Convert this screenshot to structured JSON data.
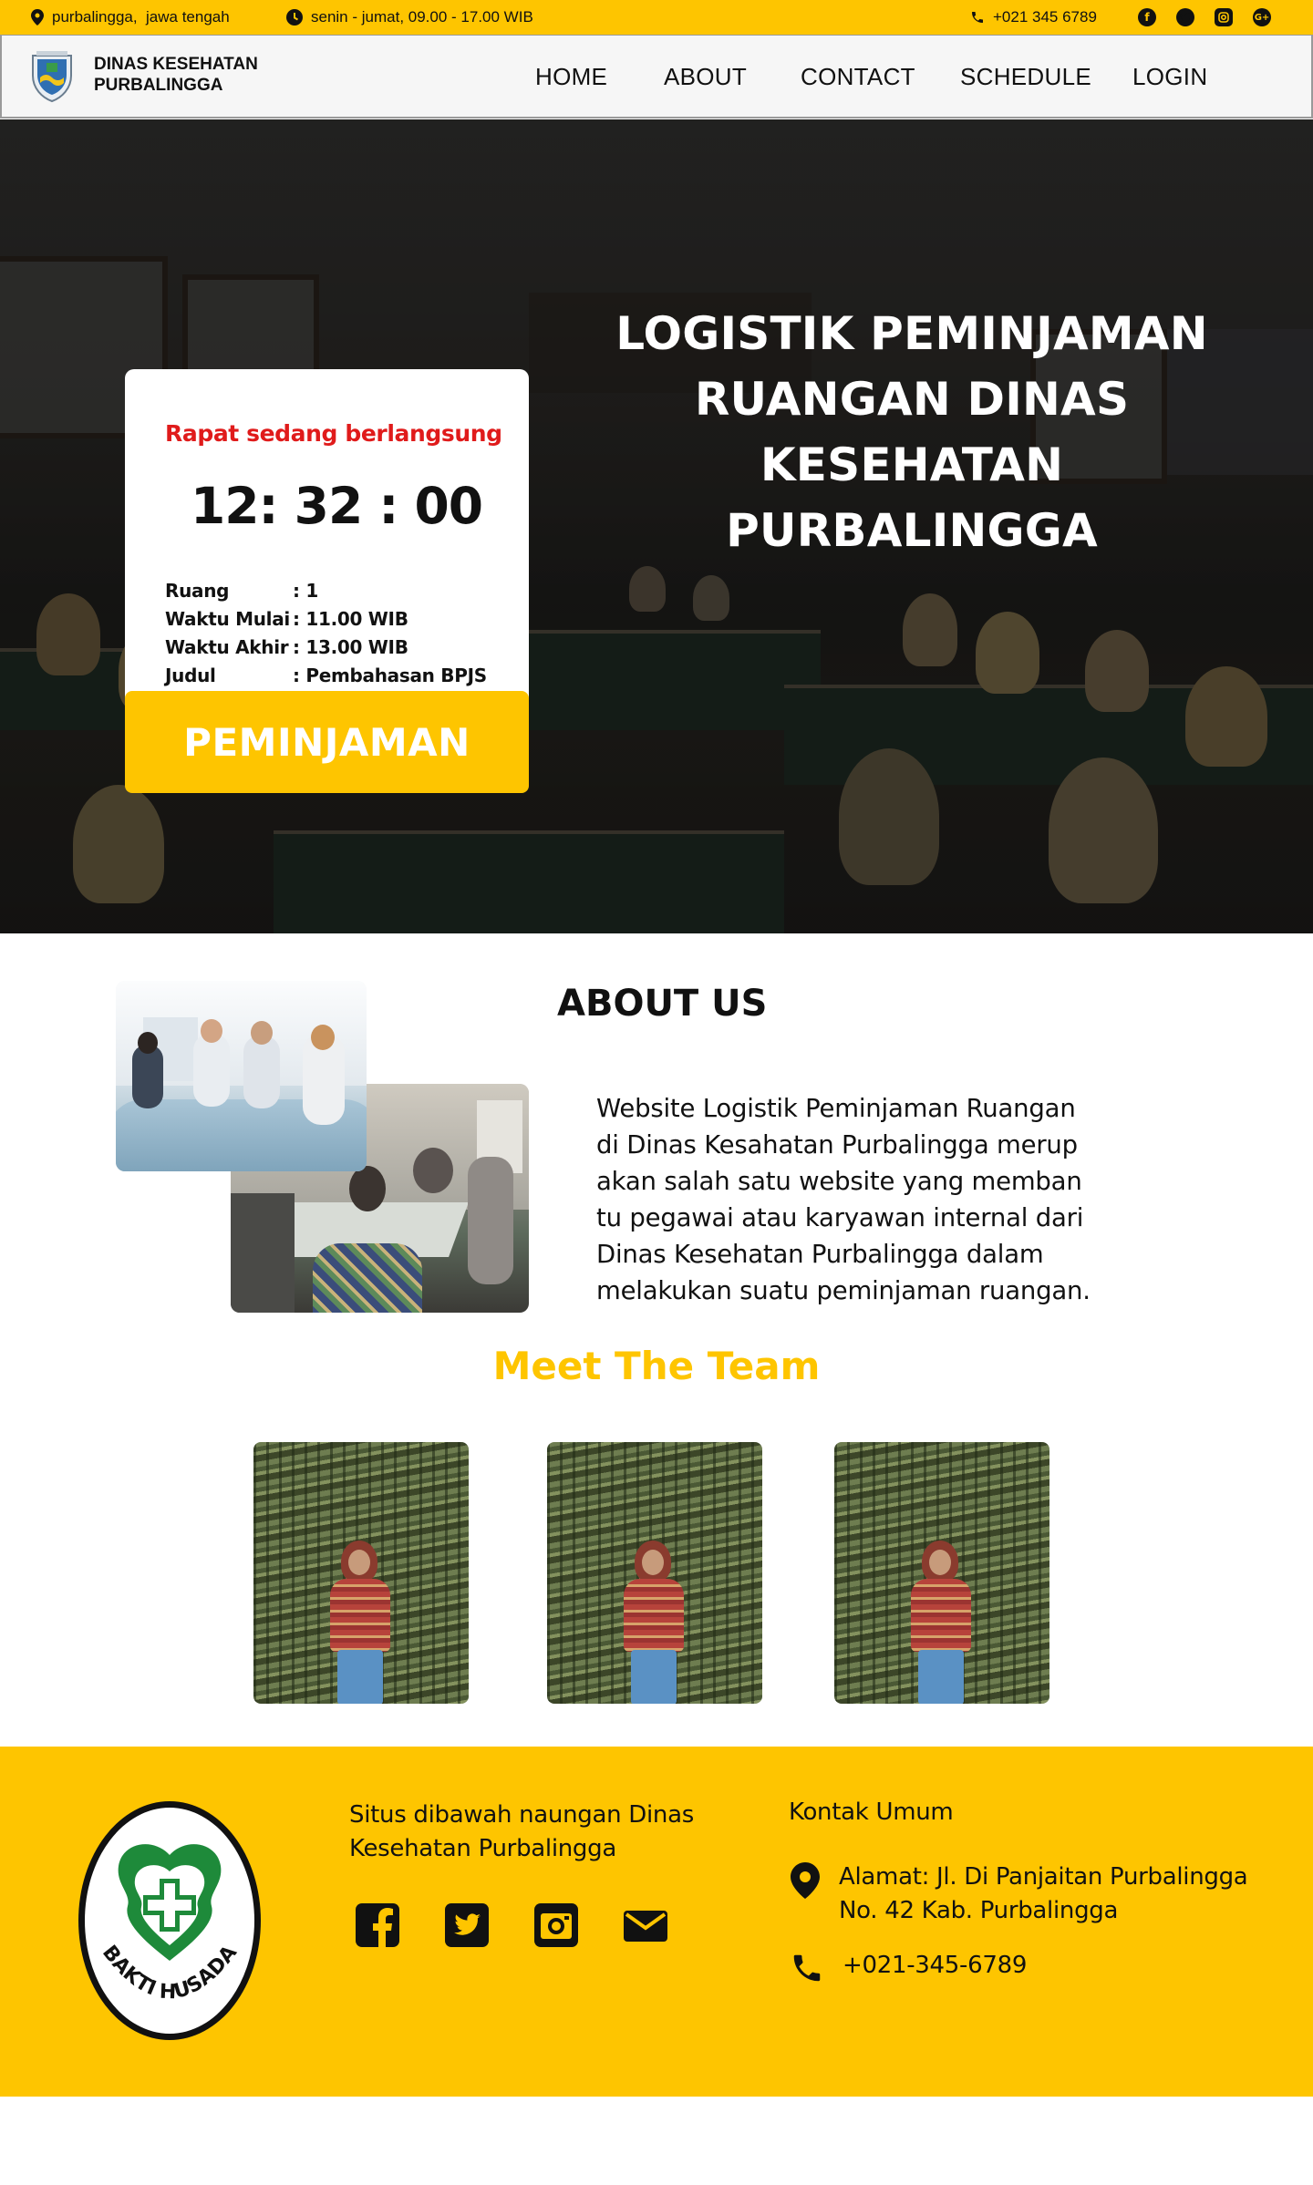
{
  "topbar": {
    "location": "purbalingga,  jawa tengah",
    "hours": "senin - jumat, 09.00 - 17.00 WIB",
    "phone": "+021 345 6789",
    "social": [
      "facebook-icon",
      "twitter-icon",
      "instagram-icon",
      "google-plus-icon"
    ]
  },
  "brand": {
    "line1": "DINAS KESEHATAN",
    "line2": "PURBALINGGA"
  },
  "nav": {
    "home": "HOME",
    "about": "ABOUT",
    "contact": "CONTACT",
    "schedule": "SCHEDULE",
    "login": "LOGIN"
  },
  "hero": {
    "title_line1": "LOGISTIK PEMINJAMAN",
    "title_line2": "RUANGAN DINAS",
    "title_line3": "KESEHATAN PURBALINGGA",
    "button": "PEMINJAMAN"
  },
  "meeting": {
    "status": "Rapat sedang berlangsung",
    "clock": "12: 32 : 00",
    "rows": [
      {
        "key": "Ruang",
        "value": ": 1"
      },
      {
        "key": "Waktu Mulai",
        "value": ": 11.00 WIB"
      },
      {
        "key": "Waktu Akhir",
        "value": ": 13.00 WIB"
      },
      {
        "key": "Judul",
        "value": ": Pembahasan BPJS"
      }
    ]
  },
  "about": {
    "title": "ABOUT US",
    "lines": [
      "Website Logistik Peminjaman Ruangan",
      "di Dinas Kesahatan Purbalingga merup",
      "akan salah satu website yang memban",
      "tu pegawai atau karyawan internal dari",
      "Dinas Kesehatan Purbalingga dalam",
      "melakukan suatu peminjaman ruangan."
    ]
  },
  "team": {
    "title": "Meet The Team"
  },
  "footer": {
    "about_line1": "Situs dibawah naungan Dinas",
    "about_line2": "Kesehatan Purbalingga",
    "logo_text": "BAKTI HUSADA",
    "contact_title": "Kontak Umum",
    "address_line1": "Alamat: Jl. Di Panjaitan Purbalingga",
    "address_line2": "No. 42 Kab. Purbalingga",
    "phone": "+021-345-6789",
    "icons": [
      "facebook-icon",
      "twitter-icon",
      "instagram-icon",
      "mail-icon"
    ]
  },
  "colors": {
    "accent": "#FEC500",
    "status_red": "#E01B1B",
    "nav_bg": "#F6F6F6"
  }
}
